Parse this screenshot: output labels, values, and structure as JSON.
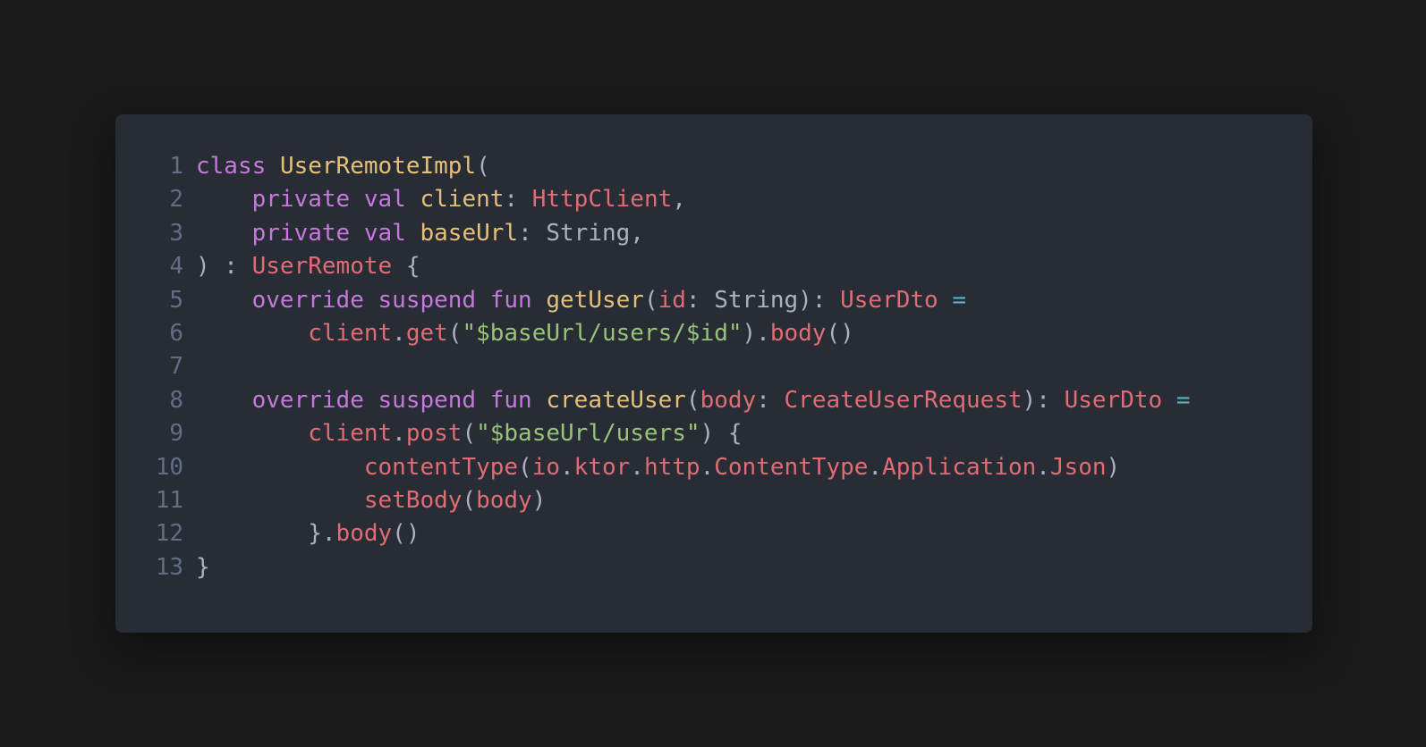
{
  "theme": {
    "background": "#1a1a1a",
    "panel": "#282c34",
    "line_number": "#636d83",
    "keyword": "#c678dd",
    "class_name": "#e5c07b",
    "type": "#e06c75",
    "string": "#98c379",
    "operator": "#56b6c2",
    "plain": "#abb2bf"
  },
  "code": {
    "language": "Kotlin",
    "lines": [
      {
        "n": "1",
        "tokens": [
          [
            "kw",
            "class"
          ],
          [
            "pn",
            " "
          ],
          [
            "cls",
            "UserRemoteImpl"
          ],
          [
            "pn",
            "("
          ]
        ]
      },
      {
        "n": "2",
        "tokens": [
          [
            "pn",
            "    "
          ],
          [
            "kw",
            "private"
          ],
          [
            "pn",
            " "
          ],
          [
            "kw",
            "val"
          ],
          [
            "pn",
            " "
          ],
          [
            "prop",
            "client"
          ],
          [
            "pn",
            ": "
          ],
          [
            "type",
            "HttpClient"
          ],
          [
            "pn",
            ","
          ]
        ]
      },
      {
        "n": "3",
        "tokens": [
          [
            "pn",
            "    "
          ],
          [
            "kw",
            "private"
          ],
          [
            "pn",
            " "
          ],
          [
            "kw",
            "val"
          ],
          [
            "pn",
            " "
          ],
          [
            "prop",
            "baseUrl"
          ],
          [
            "pn",
            ": "
          ],
          [
            "pn",
            "String"
          ],
          [
            "pn",
            ","
          ]
        ]
      },
      {
        "n": "4",
        "tokens": [
          [
            "pn",
            ") : "
          ],
          [
            "type",
            "UserRemote"
          ],
          [
            "pn",
            " {"
          ]
        ]
      },
      {
        "n": "5",
        "tokens": [
          [
            "pn",
            "    "
          ],
          [
            "kw",
            "override"
          ],
          [
            "pn",
            " "
          ],
          [
            "kw",
            "suspend"
          ],
          [
            "pn",
            " "
          ],
          [
            "kw",
            "fun"
          ],
          [
            "pn",
            " "
          ],
          [
            "fn",
            "getUser"
          ],
          [
            "pn",
            "("
          ],
          [
            "id",
            "id"
          ],
          [
            "pn",
            ": String): "
          ],
          [
            "type",
            "UserDto"
          ],
          [
            "pn",
            " "
          ],
          [
            "op",
            "="
          ]
        ]
      },
      {
        "n": "6",
        "tokens": [
          [
            "pn",
            "        "
          ],
          [
            "call",
            "client"
          ],
          [
            "pn",
            "."
          ],
          [
            "call",
            "get"
          ],
          [
            "pn",
            "("
          ],
          [
            "str",
            "\"$baseUrl/users/$id\""
          ],
          [
            "pn",
            ")."
          ],
          [
            "call",
            "body"
          ],
          [
            "pn",
            "()"
          ]
        ]
      },
      {
        "n": "7",
        "tokens": []
      },
      {
        "n": "8",
        "tokens": [
          [
            "pn",
            "    "
          ],
          [
            "kw",
            "override"
          ],
          [
            "pn",
            " "
          ],
          [
            "kw",
            "suspend"
          ],
          [
            "pn",
            " "
          ],
          [
            "kw",
            "fun"
          ],
          [
            "pn",
            " "
          ],
          [
            "fn",
            "createUser"
          ],
          [
            "pn",
            "("
          ],
          [
            "id",
            "body"
          ],
          [
            "pn",
            ": "
          ],
          [
            "type",
            "CreateUserRequest"
          ],
          [
            "pn",
            "): "
          ],
          [
            "type",
            "UserDto"
          ],
          [
            "pn",
            " "
          ],
          [
            "op",
            "="
          ]
        ]
      },
      {
        "n": "9",
        "tokens": [
          [
            "pn",
            "        "
          ],
          [
            "call",
            "client"
          ],
          [
            "pn",
            "."
          ],
          [
            "call",
            "post"
          ],
          [
            "pn",
            "("
          ],
          [
            "str",
            "\"$baseUrl/users\""
          ],
          [
            "pn",
            ") {"
          ]
        ]
      },
      {
        "n": "10",
        "tokens": [
          [
            "pn",
            "            "
          ],
          [
            "call",
            "contentType"
          ],
          [
            "pn",
            "("
          ],
          [
            "call",
            "io"
          ],
          [
            "pn",
            "."
          ],
          [
            "call",
            "ktor"
          ],
          [
            "pn",
            "."
          ],
          [
            "call",
            "http"
          ],
          [
            "pn",
            "."
          ],
          [
            "call",
            "ContentType"
          ],
          [
            "pn",
            "."
          ],
          [
            "call",
            "Application"
          ],
          [
            "pn",
            "."
          ],
          [
            "call",
            "Json"
          ],
          [
            "pn",
            ")"
          ]
        ]
      },
      {
        "n": "11",
        "tokens": [
          [
            "pn",
            "            "
          ],
          [
            "call",
            "setBody"
          ],
          [
            "pn",
            "("
          ],
          [
            "call",
            "body"
          ],
          [
            "pn",
            ")"
          ]
        ]
      },
      {
        "n": "12",
        "tokens": [
          [
            "pn",
            "        }."
          ],
          [
            "call",
            "body"
          ],
          [
            "pn",
            "()"
          ]
        ]
      },
      {
        "n": "13",
        "tokens": [
          [
            "pn",
            "}"
          ]
        ]
      }
    ]
  }
}
